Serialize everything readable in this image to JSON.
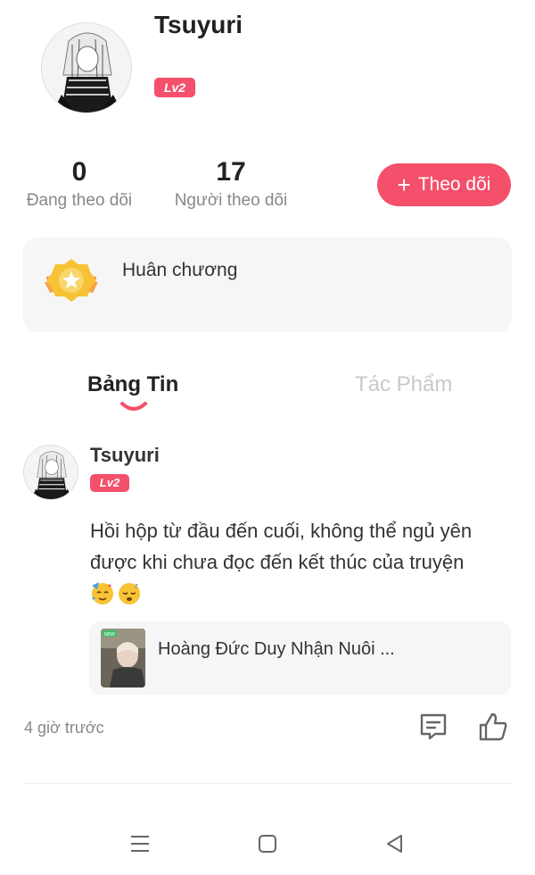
{
  "profile": {
    "username": "Tsuyuri",
    "level": "Lv2",
    "avatar_icon": "anime-character-avatar"
  },
  "stats": {
    "following_count": "0",
    "following_label": "Đang theo dõi",
    "followers_count": "17",
    "followers_label": "Người theo dõi"
  },
  "follow_button": {
    "icon": "+",
    "label": "Theo dõi"
  },
  "medal": {
    "icon": "winged-medal-icon",
    "label": "Huân chương"
  },
  "tabs": [
    {
      "label": "Bảng Tin",
      "active": true
    },
    {
      "label": "Tác Phẩm",
      "active": false
    }
  ],
  "post": {
    "username": "Tsuyuri",
    "level": "Lv2",
    "text": "Hồi hộp từ đầu đến cuối, không thể ngủ yên được khi chưa đọc đến kết thúc của truyện",
    "emojis": [
      "🥳",
      "😴"
    ],
    "book": {
      "title": "Hoàng Đức Duy Nhận Nuôi ...",
      "cover_badge": "NEW"
    },
    "time": "4 giờ trước"
  },
  "colors": {
    "accent": "#f4506b",
    "card_bg": "#f6f6f6",
    "muted_text": "#888888",
    "inactive_tab": "#c9c9c9",
    "medal_gold": "#f7c234"
  }
}
